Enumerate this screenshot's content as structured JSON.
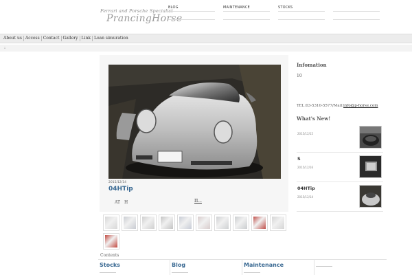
{
  "header": {
    "logo_subtitle": "Ferrari and Porsche Specialist",
    "logo_title": "PrancingHorse",
    "nav": [
      "BLOG",
      "MAINTENANCE",
      "STOCKS",
      ""
    ]
  },
  "menu": [
    "About us",
    "Access",
    "Contact",
    "Gallery",
    "Link",
    "Loan simuration"
  ],
  "breadcrumb": ":",
  "post": {
    "date": "2015/12/14",
    "title": "04HTip",
    "text": "AT　H",
    "link": "П..."
  },
  "thumbnails": [
    {
      "color": "#d7d7d7"
    },
    {
      "color": "#c9ccd2"
    },
    {
      "color": "#cfcfcf"
    },
    {
      "color": "#c4c4c4"
    },
    {
      "color": "#c8ccd6"
    },
    {
      "color": "#d8cccc"
    },
    {
      "color": "#cfd1d3"
    },
    {
      "color": "#cacdcf"
    },
    {
      "color": "#c0504a"
    },
    {
      "color": "#d5d5d5"
    },
    {
      "color": "#c24a40"
    }
  ],
  "contents_label": "Contents",
  "bottom_tabs": [
    "Stocks",
    "Blog",
    "Maintenance",
    ""
  ],
  "sidebar": {
    "info_title": "Infomation",
    "info_number": "10",
    "tel": "TEL:03-5310-5577/Mail:",
    "mail": "info@p-horse.com",
    "news_title": "What's New!",
    "news": [
      {
        "title": "",
        "date": "2015/12/15"
      },
      {
        "title": "S",
        "date": "2015/12/16"
      },
      {
        "title": "04HTip",
        "date": "2015/12/14"
      }
    ]
  },
  "colors": {
    "accent": "#3b6a93",
    "menubar": "#ececec"
  }
}
